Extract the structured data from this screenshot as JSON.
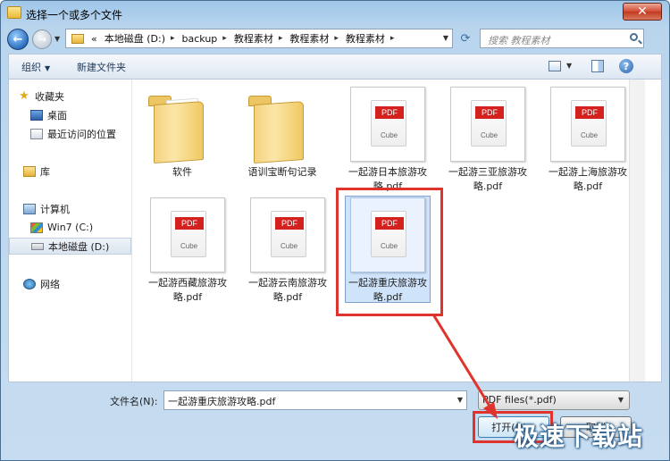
{
  "window": {
    "title": "选择一个或多个文件",
    "close_label": "✕"
  },
  "nav": {
    "back_icon": "back-arrow-icon",
    "forward_icon": "forward-arrow-icon",
    "breadcrumb": [
      "«",
      "本地磁盘 (D:)",
      "backup",
      "教程素材",
      "教程素材",
      "教程素材"
    ],
    "refresh_icon": "refresh-icon",
    "search_placeholder": "搜索 教程素材"
  },
  "toolbar": {
    "organize_label": "组织",
    "new_folder_label": "新建文件夹"
  },
  "sidebar": {
    "items": [
      {
        "label": "收藏夹",
        "icon": "star-icon"
      },
      {
        "label": "桌面",
        "icon": "desktop-icon"
      },
      {
        "label": "最近访问的位置",
        "icon": "recent-places-icon"
      },
      {
        "label": "库",
        "icon": "library-icon"
      },
      {
        "label": "计算机",
        "icon": "computer-icon"
      },
      {
        "label": "Win7 (C:)",
        "icon": "windows-drive-icon"
      },
      {
        "label": "本地磁盘 (D:)",
        "icon": "drive-icon"
      },
      {
        "label": "网络",
        "icon": "network-icon"
      }
    ]
  },
  "files": [
    {
      "label": "软件",
      "type": "folder"
    },
    {
      "label": "语训宝断句记录",
      "type": "folder"
    },
    {
      "label": "一起游日本旅游攻略.pdf",
      "type": "pdf"
    },
    {
      "label": "一起游三亚旅游攻略.pdf",
      "type": "pdf"
    },
    {
      "label": "一起游上海旅游攻略.pdf",
      "type": "pdf"
    },
    {
      "label": "一起游西藏旅游攻略.pdf",
      "type": "pdf"
    },
    {
      "label": "一起游云南旅游攻略.pdf",
      "type": "pdf"
    },
    {
      "label": "一起游重庆旅游攻略.pdf",
      "type": "pdf",
      "selected": true
    }
  ],
  "pdf_thumb": {
    "badge": "PDF",
    "brand": "Cube"
  },
  "bottom": {
    "filename_label": "文件名(N):",
    "filename_value": "一起游重庆旅游攻略.pdf",
    "filetype_value": "PDF files(*.pdf)",
    "open_label": "打开(O)",
    "cancel_label": "取消"
  },
  "watermark": "极速下载站",
  "colors": {
    "highlight": "#e0332e",
    "selection": "#cfe3fb",
    "pdf_badge": "#d5211d"
  }
}
